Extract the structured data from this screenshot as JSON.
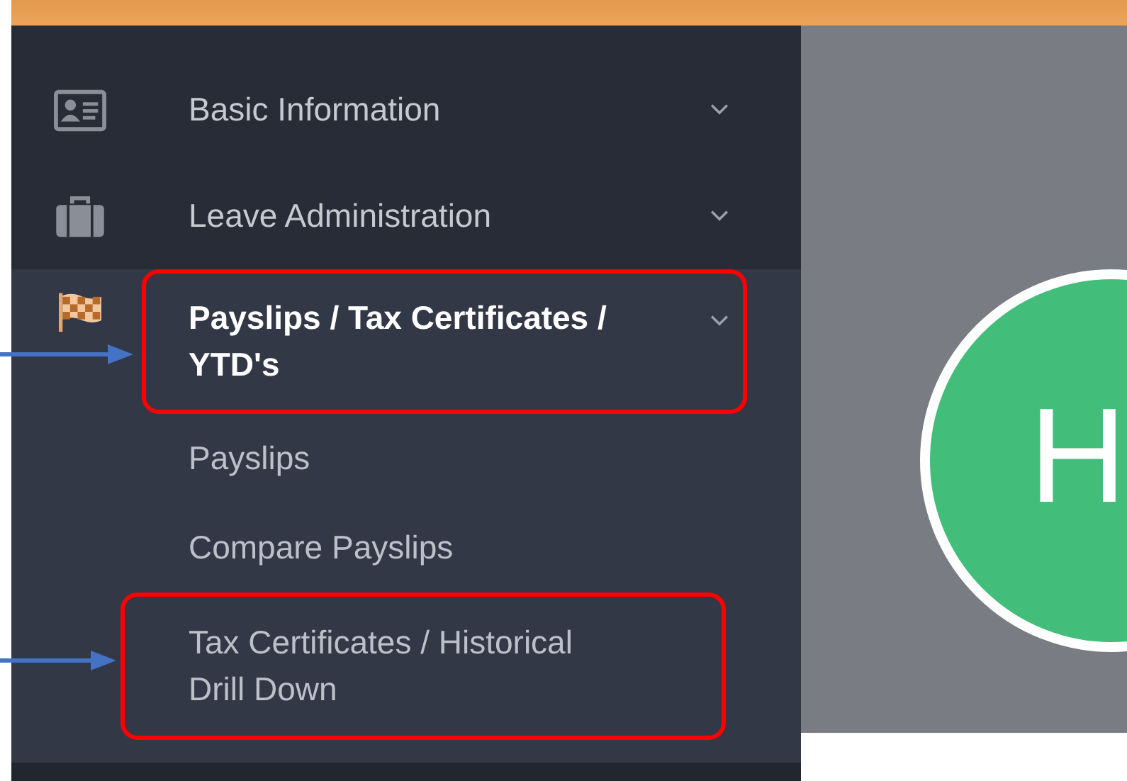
{
  "menu": [
    {
      "label": "Basic Information",
      "expanded": false,
      "annotated": false
    },
    {
      "label": "Leave Administration",
      "expanded": false,
      "annotated": false
    },
    {
      "label": "Payslips / Tax Certificates / YTD's",
      "expanded": true,
      "annotated": true,
      "children": [
        {
          "label": "Payslips",
          "annotated": false
        },
        {
          "label": "Compare Payslips",
          "annotated": false
        },
        {
          "label": "Tax Certificates / Historical Drill Down",
          "annotated": true
        }
      ]
    }
  ],
  "avatar": {
    "initial": "H"
  }
}
